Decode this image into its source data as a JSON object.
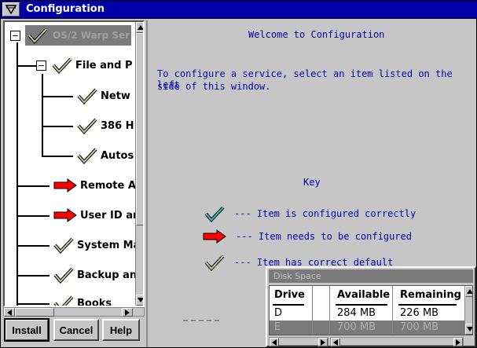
{
  "window": {
    "title": "Configuration"
  },
  "tree": {
    "root": {
      "label": "OS/2 Warp Ser"
    },
    "items": [
      {
        "label": "File and P",
        "status": "default"
      },
      {
        "label": "Netw",
        "status": "default"
      },
      {
        "label": "386 H",
        "status": "default"
      },
      {
        "label": "Autos",
        "status": "default"
      },
      {
        "label": "Remote Ac",
        "status": "needs"
      },
      {
        "label": "User ID an",
        "status": "needs"
      },
      {
        "label": "System Ma",
        "status": "default"
      },
      {
        "label": "Backup and",
        "status": "default"
      },
      {
        "label": "Books",
        "status": "default"
      }
    ],
    "collapse_symbol": "−"
  },
  "buttons": {
    "install": "Install",
    "cancel": "Cancel",
    "help": "Help"
  },
  "welcome": {
    "title": "Welcome to Configuration",
    "line1": "To configure a service, select an item listed on the left",
    "line2": "side of this window."
  },
  "key": {
    "title": "Key",
    "configured": "--- Item is configured correctly",
    "needs": "--- Item needs to be configured",
    "default": "--- Item has correct default"
  },
  "disk_space": {
    "title": "Disk Space",
    "headers": {
      "drive": "Drive",
      "available": "Available",
      "remaining": "Remaining"
    },
    "rows": [
      {
        "drive": "D",
        "available": "284 MB",
        "remaining": "226 MB"
      },
      {
        "drive": "E",
        "available": "700 MB",
        "remaining": "700 MB"
      }
    ]
  },
  "colors": {
    "title_bar": "#0000a8",
    "text_blue": "#0000a8",
    "check_default": "#c8c8a0",
    "check_configured": "#40c0c0",
    "arrow_needs": "#ff0000"
  },
  "icons": {
    "check": "check-icon",
    "arrow": "arrow-right-icon"
  }
}
